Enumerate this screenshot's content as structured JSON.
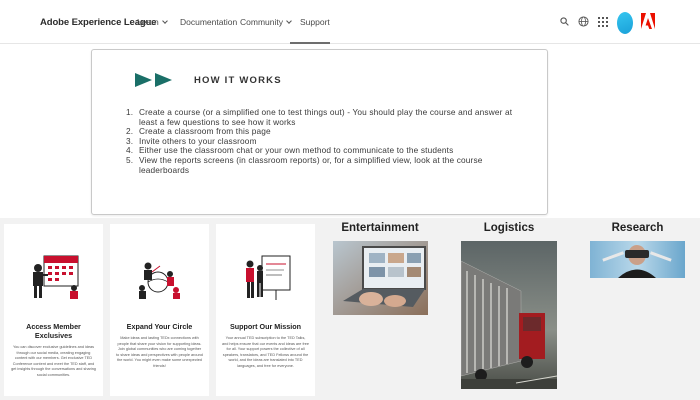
{
  "nav": {
    "brand": "Adobe Experience League",
    "items": [
      {
        "label": "Learn",
        "has_dropdown": true
      },
      {
        "label": "Documentation",
        "has_dropdown": false
      },
      {
        "label": "Community",
        "has_dropdown": true
      },
      {
        "label": "Support",
        "has_dropdown": false,
        "active": true
      }
    ],
    "icons": [
      "search-icon",
      "globe-icon",
      "apps-grid-icon",
      "avatar",
      "adobe-logo-icon"
    ],
    "adobe_red": "#eb1000",
    "avatar_color": "#2bb5e8"
  },
  "how_it_works": {
    "title": "HOW IT WORKS",
    "accent": "#1a6f68",
    "steps": [
      "Create a course (or a simplified one to test things out) - You should play the course and answer at least a few questions to see how it works",
      "Create a classroom from this page",
      "Invite others to your classroom",
      "Either use the classroom chat or your own method to communicate to the students",
      "View the reports screens (in classroom reports) or, for a simplified view, look at the course leaderboards"
    ]
  },
  "benefits": [
    {
      "title": "Access Member Exclusives",
      "description": "You can discover exclusive guidelines and ideas through our social media, creating engaging content with our members. Get exclusive TED Conference content and meet the TED staff, and get insights through the conversations and sharing social communities."
    },
    {
      "title": "Expand Your Circle",
      "description": "Make ideas and lasting TEDx connections with people that share your vision for supporting ideas. Join global communities who are coming together to share ideas and perspectives with people around the world. You might even make some unexpected friends!"
    },
    {
      "title": "Support Our Mission",
      "description": "Your annual TED subscription to the TED Talks, and helps ensure that our events and ideas are free for all. Your support powers the collective of all speakers, translators, and TED Fellows around the world, and the ideas are translated into TED languages, and free for everyone."
    }
  ],
  "industries": [
    {
      "title": "Entertainment"
    },
    {
      "title": "Logistics"
    },
    {
      "title": "Research"
    }
  ]
}
